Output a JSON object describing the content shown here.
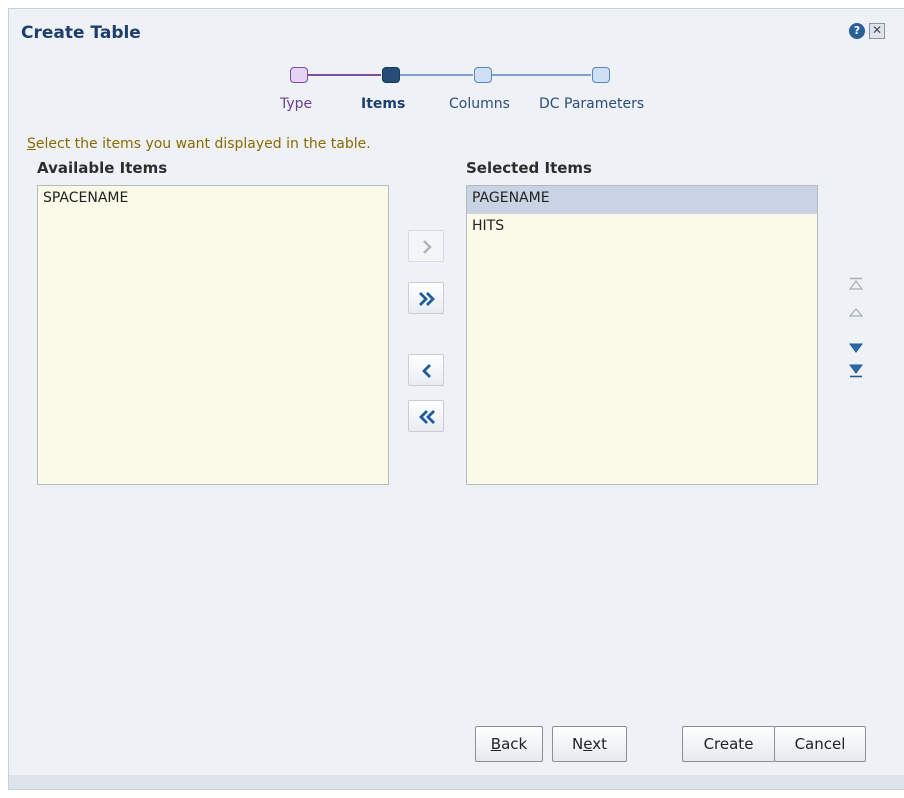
{
  "dialog": {
    "title": "Create Table",
    "help_icon": "?",
    "close_icon": "✕"
  },
  "train": {
    "stops": [
      {
        "label": "Type",
        "state": "visited"
      },
      {
        "label": "Items",
        "state": "current"
      },
      {
        "label": "Columns",
        "state": "unvisited"
      },
      {
        "label": "DC Parameters",
        "state": "unvisited"
      }
    ]
  },
  "instruction": {
    "accesskey": "S",
    "rest": "elect the items you want displayed in the table."
  },
  "available": {
    "header": "Available Items",
    "items": [
      "SPACENAME"
    ]
  },
  "selected": {
    "header": "Selected Items",
    "items": [
      {
        "label": "PAGENAME",
        "selected": true
      },
      {
        "label": "HITS",
        "selected": false
      }
    ]
  },
  "shuttle": {
    "move_icon": "move-right-icon",
    "move_all_icon": "move-all-right-icon",
    "remove_icon": "move-left-icon",
    "remove_all_icon": "move-all-left-icon"
  },
  "reorder": {
    "top_icon": "move-to-top-icon",
    "up_icon": "move-up-icon",
    "down_icon": "move-down-icon",
    "bottom_icon": "move-to-bottom-icon"
  },
  "buttons": {
    "back": {
      "ak": "B",
      "rest": "ack"
    },
    "next": {
      "pre": "N",
      "ak": "e",
      "rest": "xt"
    },
    "create": "Create",
    "cancel": "Cancel"
  },
  "colors": {
    "accent": "#1e3f6b",
    "visited": "#7f4d9e",
    "instruction": "#8a6a00",
    "list_bg": "#fafae8",
    "selected_row": "#c9d3e3"
  }
}
